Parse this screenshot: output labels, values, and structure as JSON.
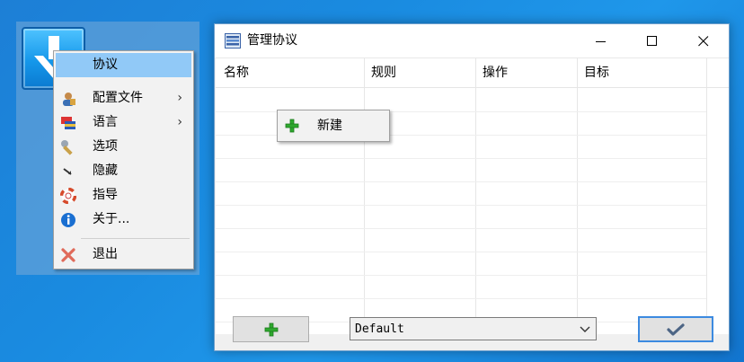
{
  "tray_menu": {
    "items": [
      {
        "label": "协议",
        "icon": "protocol-icon",
        "highlighted": true
      },
      {
        "label": "配置文件",
        "icon": "profile-user-icon",
        "submenu": true
      },
      {
        "label": "语言",
        "icon": "language-flag-icon",
        "submenu": true
      },
      {
        "label": "选项",
        "icon": "wrench-icon"
      },
      {
        "label": "隐藏",
        "icon": "hide-cursor-icon"
      },
      {
        "label": "指导",
        "icon": "lifebuoy-icon"
      },
      {
        "label": "关于...",
        "icon": "info-icon"
      },
      {
        "label": "退出",
        "icon": "exit-x-icon"
      }
    ],
    "submenu_arrow": "›"
  },
  "dialog": {
    "title": "管理协议",
    "columns": [
      "名称",
      "规则",
      "操作",
      "目标"
    ],
    "context_menu": {
      "new_label": "新建",
      "icon": "plus-icon"
    },
    "profile_select": {
      "value": "Default"
    },
    "add_button_icon": "plus-icon",
    "ok_button_icon": "checkmark-icon"
  },
  "colors": {
    "desktop": "#1a8be0",
    "menu_highlight": "#91c9f7",
    "ok_border": "#3c8ae0",
    "plus_green": "#2ea82e"
  }
}
